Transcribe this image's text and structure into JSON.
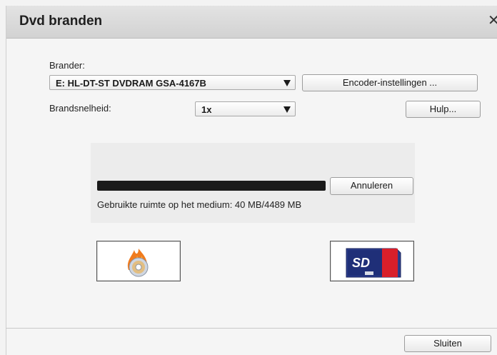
{
  "window": {
    "title": "Dvd branden"
  },
  "burner": {
    "label": "Brander:",
    "selected": "E: HL-DT-ST DVDRAM GSA-4167B",
    "encoder_button": "Encoder-instellingen ..."
  },
  "speed": {
    "label": "Brandsnelheid:",
    "selected": "1x",
    "help_button": "Hulp..."
  },
  "progress": {
    "value_fraction": 1.0,
    "cancel_button": "Annuleren",
    "status_text": "Gebruikte ruimte op het medium: 40 MB/4489 MB"
  },
  "actions": {
    "burn_icon": "flame-disc-icon",
    "sdcard_icon": "sd-card-icon"
  },
  "footer": {
    "close_button": "Sluiten"
  }
}
